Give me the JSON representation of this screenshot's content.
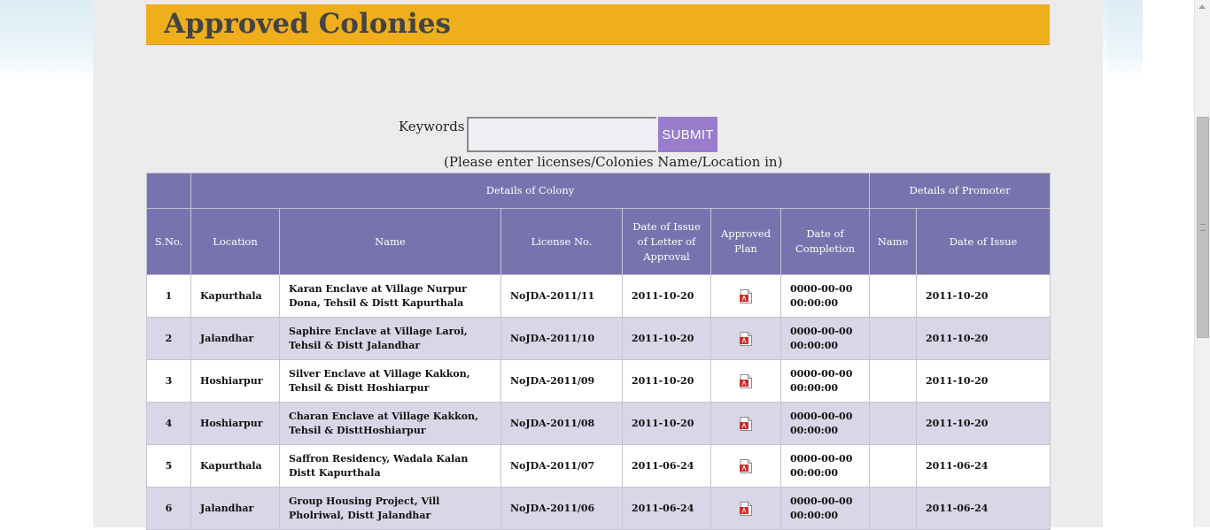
{
  "page": {
    "title": "Approved Colonies"
  },
  "search": {
    "label": "Keywords :",
    "value": "",
    "placeholder": "",
    "submit_label": "SUBMIT",
    "hint": "(Please enter licenses/Colonies Name/Location in)"
  },
  "table": {
    "group_headers": {
      "colony": "Details of Colony",
      "promoter": "Details of Promoter"
    },
    "columns": {
      "sno": "S.No.",
      "location": "Location",
      "name": "Name",
      "license": "License No.",
      "letter_date": "Date of Issue of Letter of Approval",
      "plan": "Approved Plan",
      "completion": "Date of Completion",
      "promoter_name": "Name",
      "promoter_date": "Date of Issue"
    },
    "rows": [
      {
        "sno": "1",
        "location": "Kapurthala",
        "name": "Karan Enclave at Village Nurpur Dona, Tehsil & Distt Kapurthala",
        "license": "NoJDA-2011/11",
        "letter_date": "2011-10-20",
        "plan_icon": "pdf-icon",
        "completion": "0000-00-00 00:00:00",
        "promoter_name": "",
        "promoter_date": "2011-10-20"
      },
      {
        "sno": "2",
        "location": "Jalandhar",
        "name": "Saphire Enclave at Village Laroi, Tehsil & Distt Jalandhar",
        "license": "NoJDA-2011/10",
        "letter_date": "2011-10-20",
        "plan_icon": "pdf-icon",
        "completion": "0000-00-00 00:00:00",
        "promoter_name": "",
        "promoter_date": "2011-10-20"
      },
      {
        "sno": "3",
        "location": "Hoshiarpur",
        "name": "Silver Enclave at Village Kakkon, Tehsil & Distt Hoshiarpur",
        "license": "NoJDA-2011/09",
        "letter_date": "2011-10-20",
        "plan_icon": "pdf-icon",
        "completion": "0000-00-00 00:00:00",
        "promoter_name": "",
        "promoter_date": "2011-10-20"
      },
      {
        "sno": "4",
        "location": "Hoshiarpur",
        "name": "Charan Enclave at Village Kakkon, Tehsil & DisttHoshiarpur",
        "license": "NoJDA-2011/08",
        "letter_date": "2011-10-20",
        "plan_icon": "pdf-icon",
        "completion": "0000-00-00 00:00:00",
        "promoter_name": "",
        "promoter_date": "2011-10-20"
      },
      {
        "sno": "5",
        "location": "Kapurthala",
        "name": "Saffron Residency, Wadala Kalan Distt Kapurthala",
        "license": "NoJDA-2011/07",
        "letter_date": "2011-06-24",
        "plan_icon": "pdf-icon",
        "completion": "0000-00-00 00:00:00",
        "promoter_name": "",
        "promoter_date": "2011-06-24"
      },
      {
        "sno": "6",
        "location": "Jalandhar",
        "name": "Group Housing Project, Vill Pholriwal, Distt Jalandhar",
        "license": "NoJDA-2011/06",
        "letter_date": "2011-06-24",
        "plan_icon": "pdf-icon",
        "completion": "0000-00-00 00:00:00",
        "promoter_name": "",
        "promoter_date": "2011-06-24"
      }
    ]
  },
  "colors": {
    "banner": "#efaf1d",
    "header": "#7873ae",
    "submit": "#9a7ccc",
    "row_alt": "#d8d7e7",
    "pdf_red": "#d42a2a"
  }
}
